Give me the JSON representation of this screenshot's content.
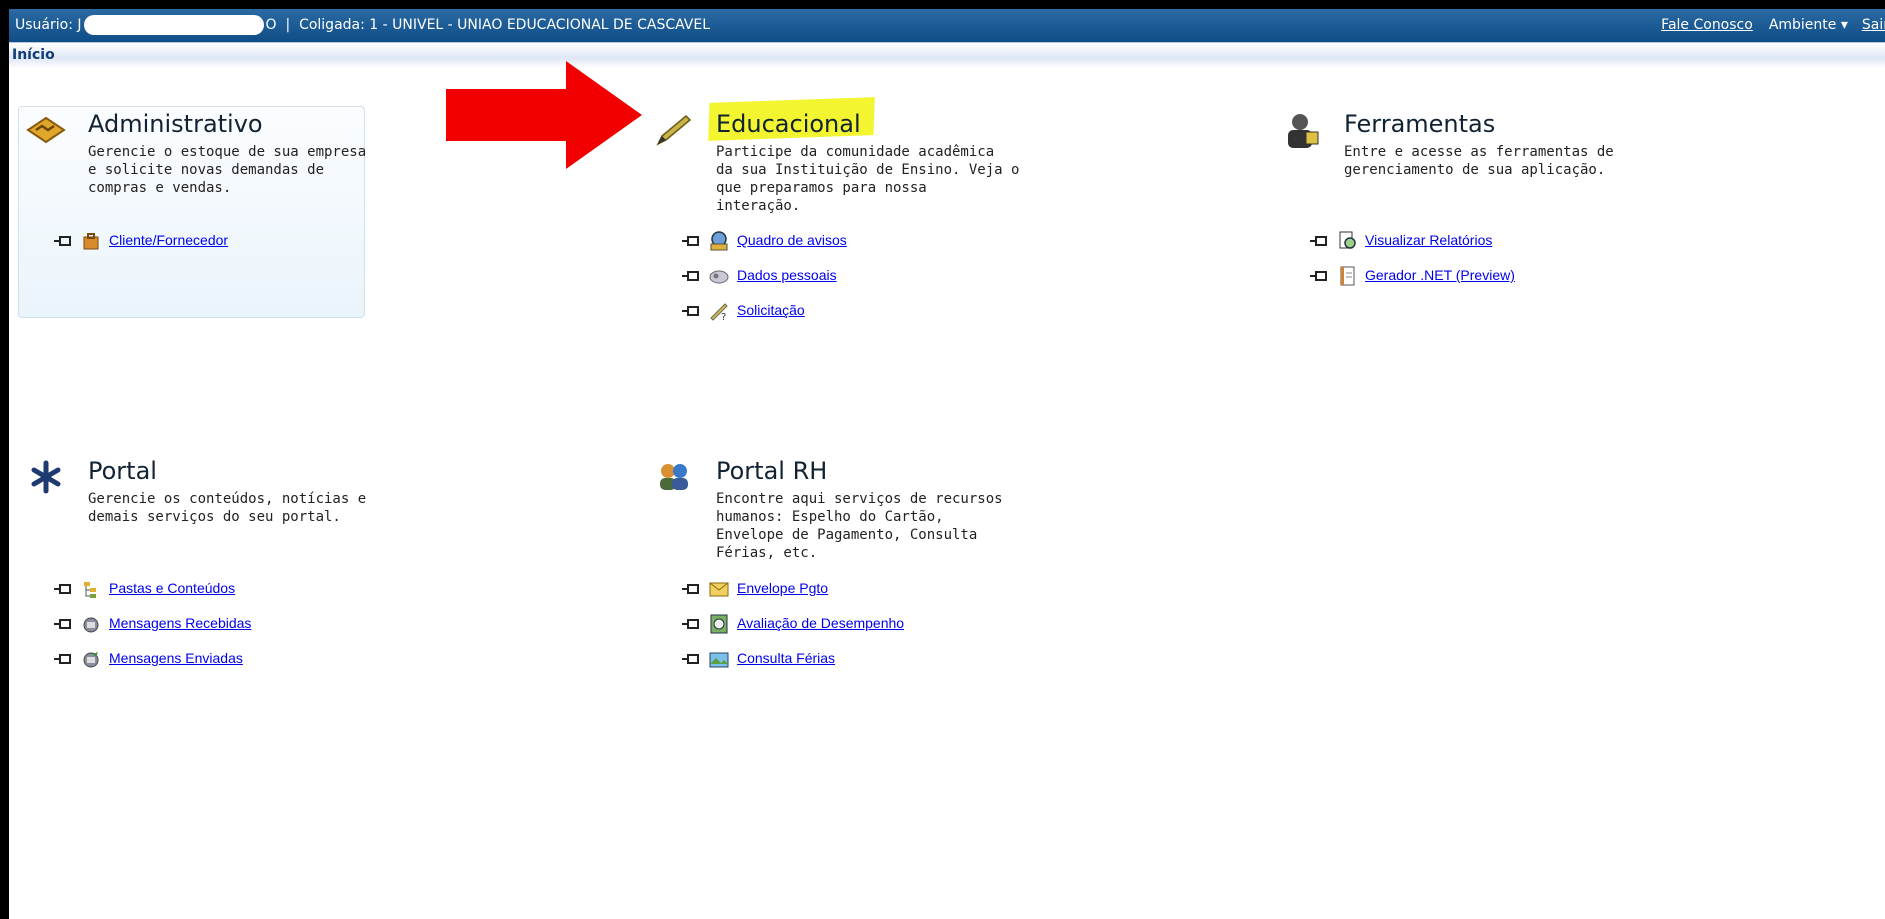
{
  "topbar": {
    "user_label": "Usuário: J",
    "user_suffix": "O",
    "separator": "|",
    "coligada": "Coligada: 1 - UNIVEL - UNIAO EDUCACIONAL DE CASCAVEL",
    "contact_link": "Fale Conosco",
    "environment_label": "Ambiente ▾",
    "exit_link": "Sair"
  },
  "breadcrumb": {
    "home": "Início"
  },
  "modules": {
    "administrativo": {
      "title": "Administrativo",
      "desc": "Gerencie o estoque de sua empresa\ne solicite novas demandas de\ncompras e vendas.",
      "icon": "handshake-icon",
      "links": [
        "Cliente/Fornecedor"
      ]
    },
    "educacional": {
      "title": "Educacional",
      "desc": "Participe da comunidade acadêmica\nda sua Instituição de Ensino. Veja o\nque preparamos para nossa\ninteração.",
      "icon": "pencil-icon",
      "links": [
        "Quadro de avisos",
        "Dados pessoais",
        "Solicitação"
      ]
    },
    "ferramentas": {
      "title": "Ferramentas",
      "desc": "Entre e acesse as ferramentas de\ngerenciamento de sua aplicação.",
      "icon": "tools-user-icon",
      "links": [
        "Visualizar Relatórios",
        "Gerador .NET (Preview)"
      ]
    },
    "portal": {
      "title": "Portal",
      "desc": "Gerencie os conteúdos, notícias e\ndemais serviços do seu portal.",
      "icon": "asterisk-icon",
      "links": [
        "Pastas e Conteúdos",
        "Mensagens Recebidas",
        "Mensagens Enviadas"
      ]
    },
    "portal_rh": {
      "title": "Portal RH",
      "desc": "Encontre aqui serviços de recursos\nhumanos: Espelho do Cartão,\nEnvelope de Pagamento, Consulta\nFérias, etc.",
      "icon": "people-icon",
      "links": [
        "Envelope Pgto",
        "Avaliação de Desempenho",
        "Consulta Férias"
      ]
    }
  },
  "colors": {
    "topbar": "#14548f",
    "link": "#0000ee",
    "arrow": "#f20000",
    "highlight": "#f3f530"
  }
}
